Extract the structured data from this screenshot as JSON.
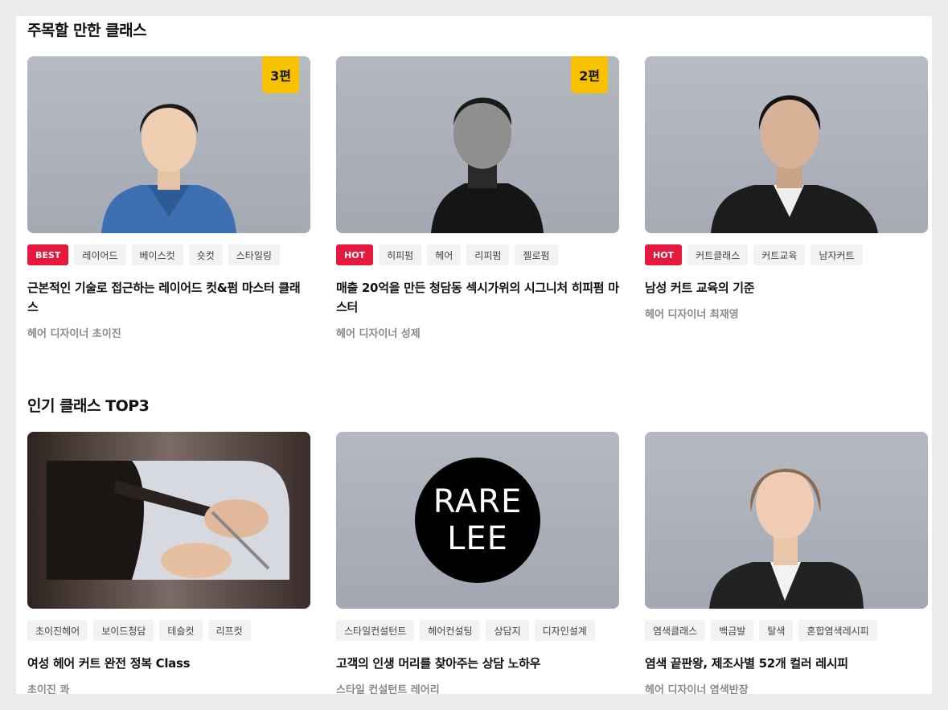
{
  "sections": [
    {
      "title": "주목할 만한 클래스",
      "cards": [
        {
          "count_badge": "3편",
          "tags": [
            {
              "label": "BEST",
              "type": "best"
            },
            {
              "label": "레이어드",
              "type": "normal"
            },
            {
              "label": "베이스컷",
              "type": "normal"
            },
            {
              "label": "숏컷",
              "type": "normal"
            },
            {
              "label": "스타일링",
              "type": "normal"
            }
          ],
          "title": "근본적인 기술로 접근하는 레이어드 컷&펌 마스터 클래스",
          "author": "헤어 디자이너 초이진"
        },
        {
          "count_badge": "2편",
          "tags": [
            {
              "label": "HOT",
              "type": "hot"
            },
            {
              "label": "히피펌",
              "type": "normal"
            },
            {
              "label": "헤어",
              "type": "normal"
            },
            {
              "label": "리피펌",
              "type": "normal"
            },
            {
              "label": "젤로펌",
              "type": "normal"
            }
          ],
          "title": "매출 20억을 만든 청담동 섹시가위의 시그니처 히피펌 마스터",
          "author": "헤어 디자이너 성제"
        },
        {
          "count_badge": "",
          "tags": [
            {
              "label": "HOT",
              "type": "hot"
            },
            {
              "label": "커트클래스",
              "type": "normal"
            },
            {
              "label": "커트교육",
              "type": "normal"
            },
            {
              "label": "남자커트",
              "type": "normal"
            }
          ],
          "title": "남성 커트 교육의 기준",
          "author": "헤어 디자이너 최재영"
        }
      ]
    },
    {
      "title": "인기 클래스 TOP3",
      "cards": [
        {
          "count_badge": "",
          "tags": [
            {
              "label": "초이진헤어",
              "type": "normal"
            },
            {
              "label": "보이드청담",
              "type": "normal"
            },
            {
              "label": "테슬컷",
              "type": "normal"
            },
            {
              "label": "리프컷",
              "type": "normal"
            }
          ],
          "title": "여성 헤어 커트 완전 정복 Class",
          "author": "초이진 콰"
        },
        {
          "count_badge": "",
          "logo_lines": [
            "RARE",
            "LEE"
          ],
          "tags": [
            {
              "label": "스타일컨설턴트",
              "type": "normal"
            },
            {
              "label": "헤어컨설팅",
              "type": "normal"
            },
            {
              "label": "상담지",
              "type": "normal"
            },
            {
              "label": "디자인설계",
              "type": "normal"
            }
          ],
          "title": "고객의 인생 머리를 찾아주는 상담 노하우",
          "author": "스타일 컨설턴트 레어리"
        },
        {
          "count_badge": "",
          "tags": [
            {
              "label": "염색클래스",
              "type": "normal"
            },
            {
              "label": "백금발",
              "type": "normal"
            },
            {
              "label": "탈색",
              "type": "normal"
            },
            {
              "label": "혼합염색레시피",
              "type": "normal"
            }
          ],
          "title": "염색 끝판왕, 제조사별 52개 컬러 레시피",
          "author": "헤어 디자이너 염색반장"
        }
      ]
    }
  ]
}
